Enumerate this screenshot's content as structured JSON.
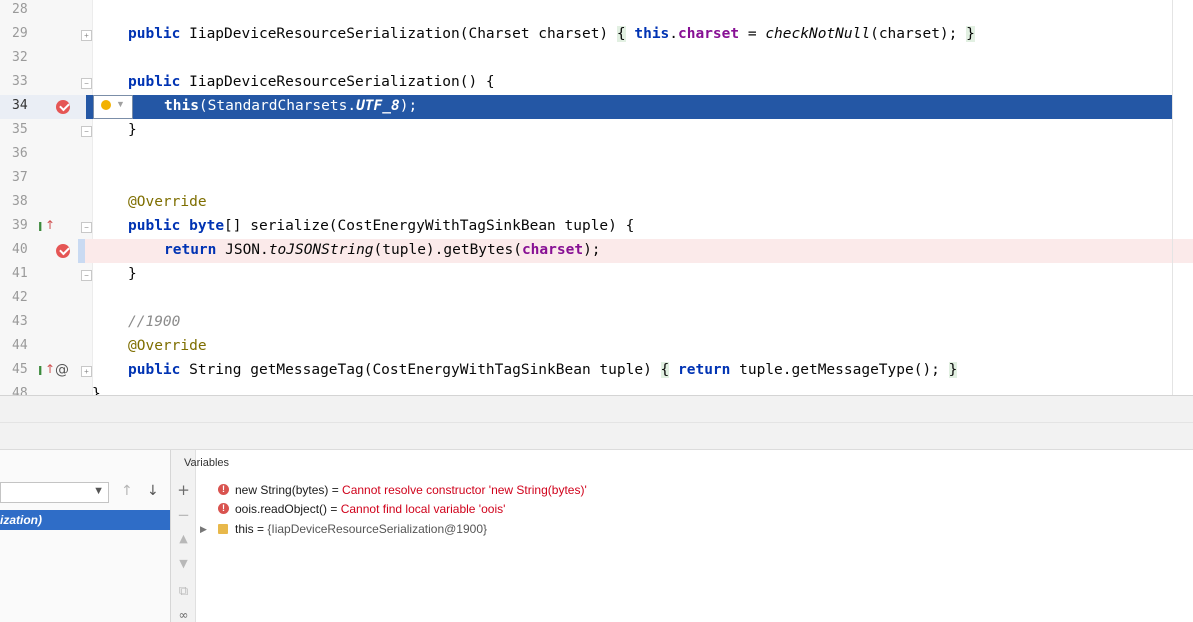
{
  "editor": {
    "line_numbers": [
      "28",
      "29",
      "32",
      "33",
      "34",
      "35",
      "36",
      "37",
      "38",
      "39",
      "40",
      "41",
      "42",
      "43",
      "44",
      "45",
      "48"
    ],
    "lines": {
      "l29": {
        "kw1": "public",
        "t1": " IiapDeviceResourceSerialization(Charset charset) ",
        "b1": "{",
        "t2": " ",
        "kw2": "this",
        "t3": ".",
        "fld": "charset",
        "t4": " = ",
        "it": "checkNotNull",
        "t5": "(charset); ",
        "b2": "}"
      },
      "l33": {
        "kw1": "public",
        "t1": " IiapDeviceResourceSerialization() {"
      },
      "l34": {
        "kw1": "this",
        "t1": "(StandardCharsets.",
        "it": "UTF_8",
        "t2": ");"
      },
      "l35": {
        "t1": "}"
      },
      "l38": {
        "ann": "@Override"
      },
      "l39": {
        "kw1": "public",
        "t1": " ",
        "kw2": "byte",
        "t2": "[] serialize(CostEnergyWithTagSinkBean tuple) {"
      },
      "l40": {
        "kw1": "return",
        "t1": " JSON.",
        "it": "toJSONString",
        "t2": "(tuple).getBytes(",
        "fld": "charset",
        "t3": ");"
      },
      "l41": {
        "t1": "}"
      },
      "l43": {
        "cmt": "//1900"
      },
      "l44": {
        "ann": "@Override"
      },
      "l45": {
        "kw1": "public",
        "t1": " String getMessageTag(CostEnergyWithTagSinkBean tuple) ",
        "b1": "{",
        "t2": " ",
        "kw2": "return",
        "t3": " tuple.getMessageType(); ",
        "b2": "}"
      },
      "l48": {
        "t1": "}"
      }
    },
    "icons": [
      "breakpoint-icon",
      "override-icon",
      "implements-icon",
      "intention-bulb-icon",
      "fold-icon"
    ]
  },
  "debugger": {
    "frame_selected": "ization)",
    "variables_header": "Variables",
    "variables": [
      {
        "name": "new String(bytes) = ",
        "value": "Cannot resolve constructor 'new String(bytes)'",
        "kind": "error"
      },
      {
        "name": "oois.readObject() = ",
        "value": "Cannot find local variable 'oois'",
        "kind": "error"
      },
      {
        "name": "this = ",
        "value": "{IiapDeviceResourceSerialization@1900}",
        "kind": "object"
      }
    ]
  },
  "colors": {
    "selection": "#2457a5",
    "keyword": "#0033b3",
    "field": "#871094",
    "error": "#d0021b",
    "breakpoint": "#e55655",
    "breakpoint_line": "#fbeaea",
    "frame_selected": "#2f6dc7"
  }
}
